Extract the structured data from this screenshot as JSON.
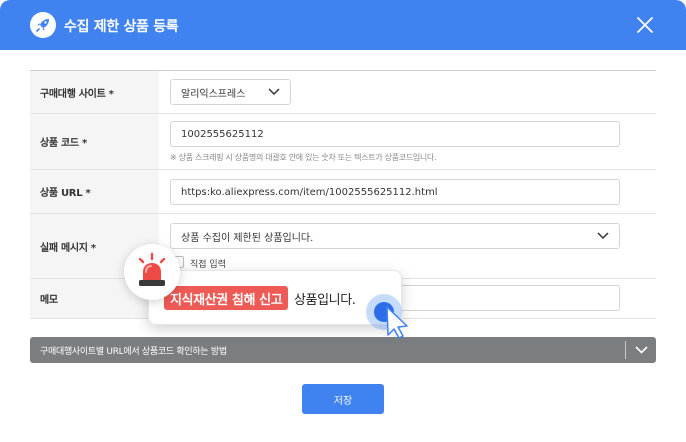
{
  "header": {
    "title": "수집 제한 상품 등록",
    "logo_icon": "rocket-icon",
    "close_icon": "close-icon",
    "background": "#3f82f0"
  },
  "form": {
    "site": {
      "label": "구매대행 사이트 *",
      "value": "알리익스프레스"
    },
    "product_code": {
      "label": "상품 코드 *",
      "value": "1002555625112",
      "hint": "※ 상품 스크래핑 시 상품명의 대괄호 안에 있는 숫자 또는 텍스트가 상품코드입니다."
    },
    "product_url": {
      "label": "상품 URL *",
      "value": "https:ko.aliexpress.com/item/1002555625112.html"
    },
    "fail_message": {
      "label": "실패 메시지 *",
      "value": "상품 수집이 제한된 상품입니다.",
      "direct_input_label": "직접 입력"
    },
    "memo": {
      "label": "메모",
      "value": ""
    }
  },
  "guide": {
    "text": "구매대행사이트별 URL에서 상품코드 확인하는 방법"
  },
  "save_label": "저장",
  "popup": {
    "tag": "지식재산권 침해 신고",
    "rest": "상품입니다.",
    "tag_color": "#ee5a55",
    "icon": "siren-icon"
  }
}
